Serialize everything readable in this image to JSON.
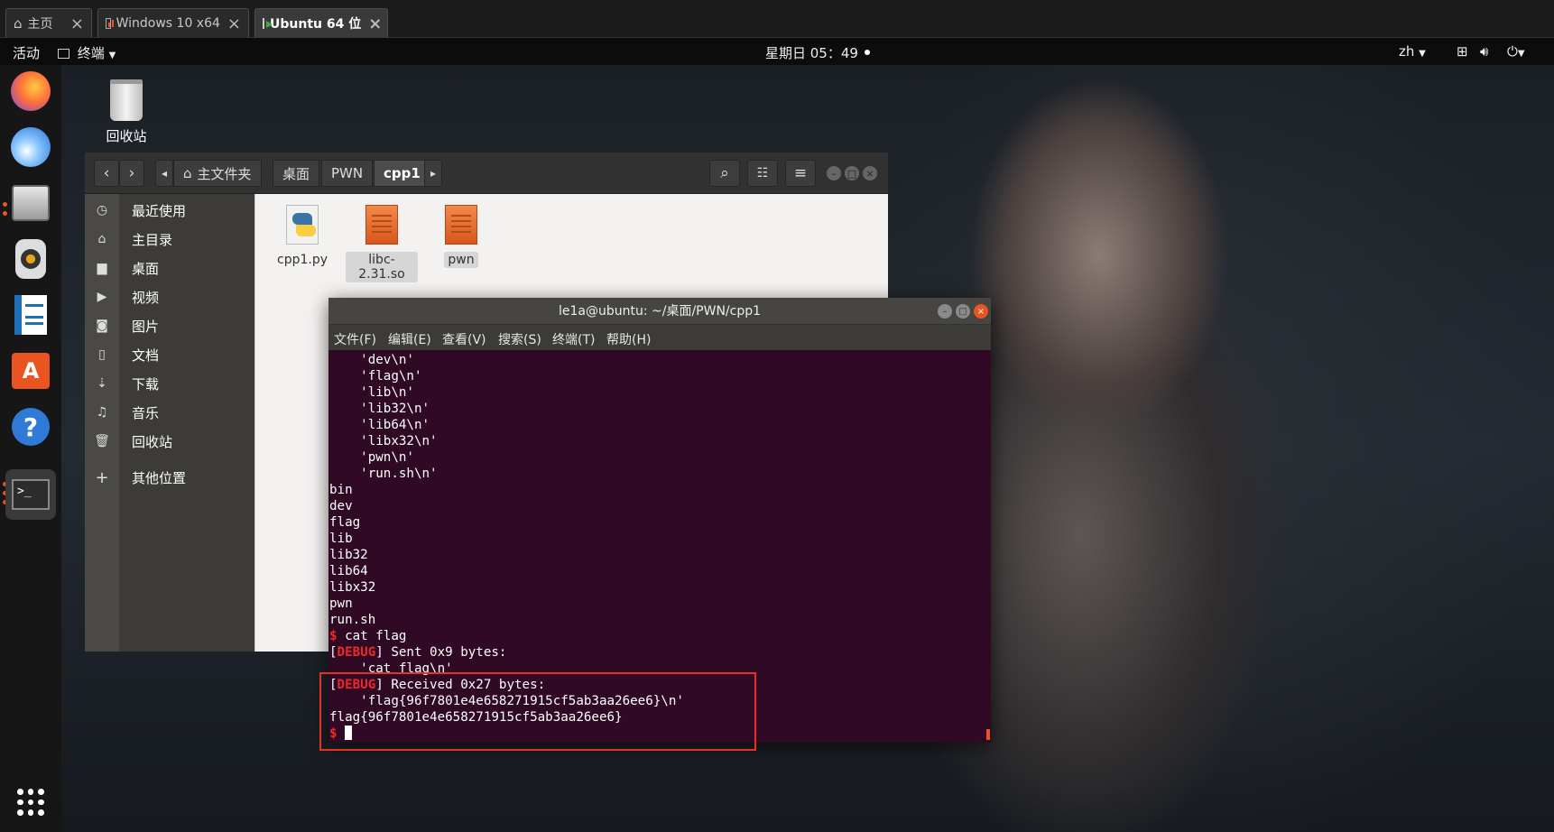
{
  "vm_tabs": [
    {
      "label": "主页",
      "icon": "home-icon"
    },
    {
      "label": "Windows 10 x64",
      "icon": "vm-icon"
    },
    {
      "label": "Ubuntu 64 位",
      "icon": "vm-running-icon"
    }
  ],
  "topbar": {
    "activities": "活动",
    "app_menu": "终端",
    "clock": "星期日 05：49",
    "lang": "zh"
  },
  "desktop": {
    "trash_label": "回收站"
  },
  "dock": [
    "firefox-icon",
    "thunderbird-icon",
    "files-icon",
    "rhythmbox-icon",
    "writer-icon",
    "software-icon",
    "help-icon",
    "terminal-icon",
    "show-apps-icon"
  ],
  "file_manager": {
    "breadcrumbs": [
      "主文件夹",
      "桌面",
      "PWN",
      "cpp1"
    ],
    "sidebar": [
      "最近使用",
      "主目录",
      "桌面",
      "视频",
      "图片",
      "文档",
      "下载",
      "音乐",
      "回收站",
      "其他位置"
    ],
    "files": [
      {
        "name": "cpp1.py",
        "type": "python"
      },
      {
        "name": "libc-2.31.so",
        "type": "binary"
      },
      {
        "name": "pwn",
        "type": "binary"
      }
    ]
  },
  "terminal": {
    "title": "le1a@ubuntu: ~/桌面/PWN/cpp1",
    "menu": [
      "文件(F)",
      "编辑(E)",
      "查看(V)",
      "搜索(S)",
      "终端(T)",
      "帮助(H)"
    ],
    "lines": [
      "    'dev\\n'",
      "    'flag\\n'",
      "    'lib\\n'",
      "    'lib32\\n'",
      "    'lib64\\n'",
      "    'libx32\\n'",
      "    'pwn\\n'",
      "    'run.sh\\n'",
      "bin",
      "dev",
      "flag",
      "lib",
      "lib32",
      "lib64",
      "libx32",
      "pwn",
      "run.sh"
    ],
    "prompt_symbol": "$",
    "command": " cat flag",
    "debug_tag": "DEBUG",
    "sent_line": "] Sent 0x9 bytes:",
    "sent_payload": "    'cat flag\\n'",
    "recv_line": "] Received 0x27 bytes:",
    "recv_payload": "    'flag{96f7801e4e658271915cf5ab3aa26ee6}\\n'",
    "flag_output": "flag{96f7801e4e658271915cf5ab3aa26ee6}"
  }
}
